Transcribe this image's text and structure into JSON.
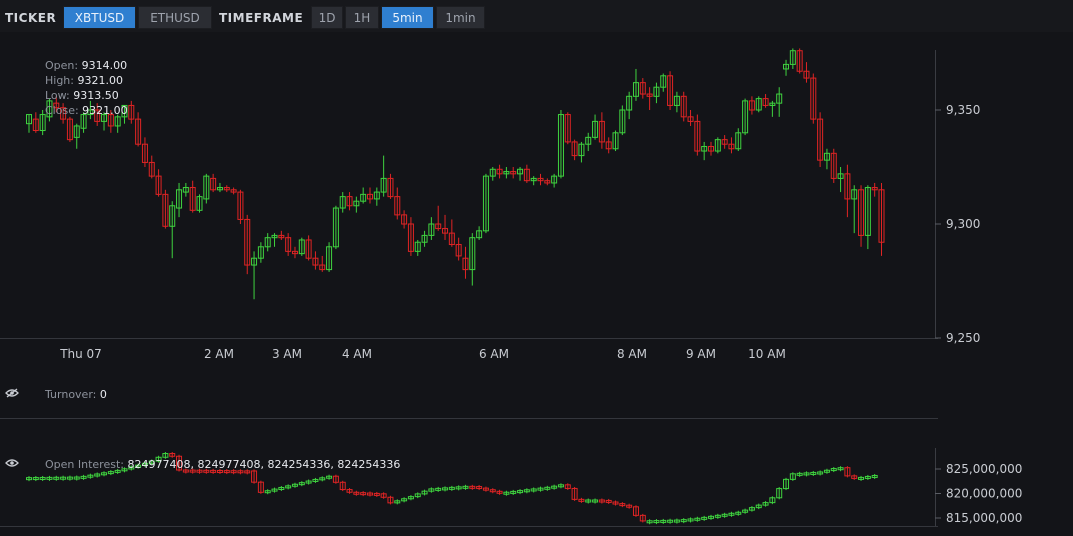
{
  "toolbar": {
    "ticker_label": "TICKER",
    "tickers": [
      "XBTUSD",
      "ETHUSD"
    ],
    "active_ticker": "XBTUSD",
    "timeframe_label": "TIMEFRAME",
    "timeframes": [
      "1D",
      "1H",
      "5min",
      "1min"
    ],
    "active_timeframe": "5min"
  },
  "ohlc_legend": {
    "open_label": "Open:",
    "open": "9314.00",
    "high_label": "High:",
    "high": "9321.00",
    "low_label": "Low:",
    "low": "9313.50",
    "close_label": "Close:",
    "close": "9321.00"
  },
  "turnover": {
    "label": "Turnover:",
    "value": "0"
  },
  "open_interest": {
    "label": "Open Interest:",
    "value": "824977408, 824977408, 824254336, 824254336"
  },
  "colors": {
    "up": "#3fd33f",
    "down": "#e02424",
    "accent": "#2f7fd0",
    "background": "#131418"
  },
  "chart_data": [
    {
      "type": "candlestick",
      "x": [
        "Thu 07",
        "2 AM",
        "3 AM",
        "4 AM",
        "6 AM",
        "8 AM",
        "9 AM",
        "10 AM"
      ],
      "y_ticks": [
        "9,250",
        "9,300",
        "9,350"
      ],
      "ylim": [
        9250,
        9375
      ],
      "series": [
        {
          "values": [
            [
              9344,
              9348,
              9340,
              9348
            ],
            [
              9346,
              9349,
              9340,
              9341
            ],
            [
              9341,
              9350,
              9339,
              9348
            ],
            [
              9347,
              9355,
              9345,
              9354
            ],
            [
              9353,
              9356,
              9349,
              9351
            ],
            [
              9351,
              9353,
              9344,
              9346
            ],
            [
              9346,
              9347,
              9336,
              9337
            ],
            [
              9338,
              9344,
              9333,
              9343
            ],
            [
              9342,
              9349,
              9340,
              9348
            ],
            [
              9348,
              9354,
              9346,
              9350
            ],
            [
              9350,
              9353,
              9343,
              9345
            ],
            [
              9345,
              9349,
              9341,
              9348
            ],
            [
              9348,
              9350,
              9340,
              9343
            ],
            [
              9343,
              9348,
              9340,
              9347
            ],
            [
              9347,
              9352,
              9344,
              9352
            ],
            [
              9352,
              9354,
              9344,
              9346
            ],
            [
              9346,
              9349,
              9334,
              9335
            ],
            [
              9335,
              9338,
              9325,
              9327
            ],
            [
              9327,
              9330,
              9320,
              9321
            ],
            [
              9321,
              9324,
              9312,
              9313
            ],
            [
              9313,
              9315,
              9298,
              9299
            ],
            [
              9299,
              9310,
              9285,
              9308
            ],
            [
              9307,
              9318,
              9303,
              9315
            ],
            [
              9314,
              9318,
              9312,
              9316
            ],
            [
              9316,
              9319,
              9305,
              9306
            ],
            [
              9306,
              9313,
              9305,
              9312
            ],
            [
              9311,
              9322,
              9309,
              9321
            ],
            [
              9320,
              9322,
              9314,
              9315
            ],
            [
              9315,
              9318,
              9314,
              9316
            ],
            [
              9316,
              9317,
              9314,
              9315
            ],
            [
              9315,
              9316,
              9313,
              9314
            ],
            [
              9314,
              9315,
              9300,
              9302
            ],
            [
              9302,
              9304,
              9278,
              9282
            ],
            [
              9282,
              9288,
              9267,
              9285
            ],
            [
              9285,
              9292,
              9283,
              9290
            ],
            [
              9290,
              9296,
              9288,
              9294
            ],
            [
              9294,
              9296,
              9290,
              9295
            ],
            [
              9295,
              9297,
              9293,
              9294
            ],
            [
              9294,
              9296,
              9286,
              9288
            ],
            [
              9288,
              9290,
              9285,
              9287
            ],
            [
              9287,
              9294,
              9286,
              9293
            ],
            [
              9293,
              9295,
              9284,
              9285
            ],
            [
              9285,
              9288,
              9280,
              9282
            ],
            [
              9282,
              9286,
              9279,
              9280
            ],
            [
              9280,
              9292,
              9279,
              9290
            ],
            [
              9290,
              9308,
              9289,
              9307
            ],
            [
              9307,
              9314,
              9305,
              9312
            ],
            [
              9312,
              9314,
              9306,
              9308
            ],
            [
              9308,
              9312,
              9305,
              9310
            ],
            [
              9310,
              9316,
              9309,
              9313
            ],
            [
              9313,
              9316,
              9309,
              9311
            ],
            [
              9311,
              9316,
              9308,
              9314
            ],
            [
              9314,
              9330,
              9312,
              9320
            ],
            [
              9320,
              9322,
              9311,
              9312
            ],
            [
              9312,
              9316,
              9302,
              9304
            ],
            [
              9304,
              9306,
              9298,
              9300
            ],
            [
              9300,
              9303,
              9286,
              9288
            ],
            [
              9288,
              9293,
              9286,
              9292
            ],
            [
              9292,
              9297,
              9290,
              9295
            ],
            [
              9295,
              9303,
              9293,
              9300
            ],
            [
              9300,
              9308,
              9297,
              9298
            ],
            [
              9298,
              9304,
              9293,
              9296
            ],
            [
              9296,
              9302,
              9290,
              9291
            ],
            [
              9291,
              9294,
              9284,
              9286
            ],
            [
              9285,
              9290,
              9276,
              9280
            ],
            [
              9280,
              9296,
              9273,
              9294
            ],
            [
              9294,
              9299,
              9293,
              9297
            ],
            [
              9297,
              9322,
              9296,
              9321
            ],
            [
              9321,
              9325,
              9319,
              9324
            ],
            [
              9324,
              9326,
              9320,
              9322
            ],
            [
              9322,
              9325,
              9320,
              9323
            ],
            [
              9323,
              9325,
              9320,
              9322
            ],
            [
              9322,
              9325,
              9319,
              9324
            ],
            [
              9324,
              9326,
              9318,
              9319
            ],
            [
              9319,
              9321,
              9317,
              9320
            ],
            [
              9320,
              9322,
              9317,
              9319
            ],
            [
              9319,
              9320,
              9317,
              9318
            ],
            [
              9318,
              9322,
              9316,
              9321
            ],
            [
              9321,
              9350,
              9320,
              9348
            ],
            [
              9348,
              9349,
              9335,
              9336
            ],
            [
              9336,
              9337,
              9328,
              9330
            ],
            [
              9330,
              9336,
              9327,
              9335
            ],
            [
              9335,
              9340,
              9332,
              9338
            ],
            [
              9338,
              9348,
              9337,
              9345
            ],
            [
              9345,
              9349,
              9333,
              9336
            ],
            [
              9336,
              9338,
              9331,
              9333
            ],
            [
              9333,
              9341,
              9332,
              9340
            ],
            [
              9340,
              9352,
              9339,
              9350
            ],
            [
              9350,
              9358,
              9346,
              9356
            ],
            [
              9356,
              9368,
              9354,
              9362
            ],
            [
              9362,
              9364,
              9355,
              9357
            ],
            [
              9357,
              9360,
              9350,
              9356
            ],
            [
              9356,
              9362,
              9353,
              9360
            ],
            [
              9360,
              9366,
              9358,
              9365
            ],
            [
              9365,
              9367,
              9350,
              9352
            ],
            [
              9352,
              9358,
              9349,
              9356
            ],
            [
              9356,
              9358,
              9345,
              9347
            ],
            [
              9347,
              9350,
              9343,
              9345
            ],
            [
              9345,
              9348,
              9330,
              9332
            ],
            [
              9332,
              9336,
              9328,
              9334
            ],
            [
              9334,
              9336,
              9330,
              9332
            ],
            [
              9332,
              9338,
              9331,
              9337
            ],
            [
              9337,
              9339,
              9333,
              9335
            ],
            [
              9335,
              9338,
              9331,
              9333
            ],
            [
              9333,
              9342,
              9332,
              9340
            ],
            [
              9340,
              9355,
              9339,
              9354
            ],
            [
              9354,
              9356,
              9348,
              9350
            ],
            [
              9350,
              9356,
              9349,
              9355
            ],
            [
              9355,
              9357,
              9351,
              9352
            ],
            [
              9352,
              9354,
              9347,
              9353
            ],
            [
              9353,
              9360,
              9347,
              9357
            ],
            [
              9368,
              9372,
              9365,
              9370
            ],
            [
              9370,
              9377,
              9368,
              9376
            ],
            [
              9376,
              9377,
              9366,
              9367
            ],
            [
              9367,
              9371,
              9362,
              9364
            ],
            [
              9364,
              9366,
              9344,
              9346
            ],
            [
              9346,
              9349,
              9325,
              9328
            ],
            [
              9328,
              9333,
              9324,
              9331
            ],
            [
              9331,
              9333,
              9318,
              9320
            ],
            [
              9320,
              9325,
              9314,
              9322
            ],
            [
              9322,
              9326,
              9303,
              9311
            ],
            [
              9311,
              9317,
              9296,
              9315
            ],
            [
              9315,
              9317,
              9290,
              9295
            ],
            [
              9295,
              9317,
              9289,
              9316
            ],
            [
              9316,
              9318,
              9312,
              9315
            ],
            [
              9315,
              9318,
              9286,
              9292
            ]
          ]
        }
      ]
    },
    {
      "type": "bar",
      "title": "Turnover",
      "values": []
    },
    {
      "type": "candlestick",
      "title": "Open Interest",
      "y_ticks": [
        "815,000,000",
        "820,000,000",
        "825,000,000"
      ],
      "ylim": [
        813500000,
        827500000
      ]
    }
  ]
}
